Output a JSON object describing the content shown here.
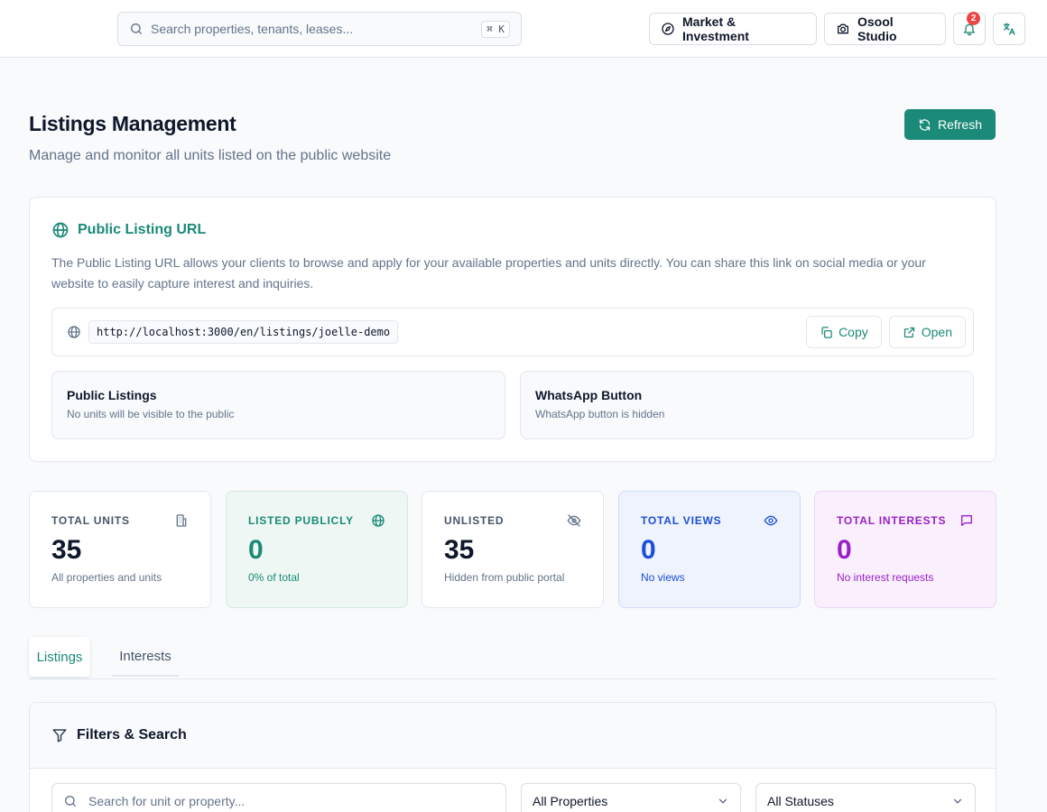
{
  "topbar": {
    "search_placeholder": "Search properties, tenants, leases...",
    "search_shortcut": "⌘ K",
    "market_label": "Market & Investment",
    "studio_label": "Osool Studio",
    "notification_count": "2"
  },
  "page": {
    "title": "Listings Management",
    "subtitle": "Manage and monitor all units listed on the public website",
    "refresh_label": "Refresh"
  },
  "public_url": {
    "title": "Public Listing URL",
    "description": "The Public Listing URL allows your clients to browse and apply for your available properties and units directly. You can share this link on social media or your website to easily capture interest and inquiries.",
    "url": "http://localhost:3000/en/listings/joelle-demo",
    "copy_label": "Copy",
    "open_label": "Open",
    "toggles": [
      {
        "title": "Public Listings",
        "desc": "No units will be visible to the public"
      },
      {
        "title": "WhatsApp Button",
        "desc": "WhatsApp button is hidden"
      }
    ]
  },
  "stats": [
    {
      "label": "TOTAL UNITS",
      "value": "35",
      "foot": "All properties and units",
      "icon": "building-icon"
    },
    {
      "label": "LISTED PUBLICLY",
      "value": "0",
      "foot": "0% of total",
      "icon": "globe-icon"
    },
    {
      "label": "UNLISTED",
      "value": "35",
      "foot": "Hidden from public portal",
      "icon": "eye-off-icon"
    },
    {
      "label": "TOTAL VIEWS",
      "value": "0",
      "foot": "No views",
      "icon": "eye-icon"
    },
    {
      "label": "TOTAL INTERESTS",
      "value": "0",
      "foot": "No interest requests",
      "icon": "message-icon"
    }
  ],
  "tabs": [
    {
      "label": "Listings",
      "active": true
    },
    {
      "label": "Interests",
      "active": false
    }
  ],
  "filters": {
    "title": "Filters & Search",
    "search_placeholder": "Search for unit or property...",
    "property_select": "All Properties",
    "status_select": "All Statuses"
  },
  "colors": {
    "brand": "#1b8a78",
    "blue": "#1d4ed8",
    "purple": "#9a1fc7",
    "badge": "#ef4444"
  }
}
